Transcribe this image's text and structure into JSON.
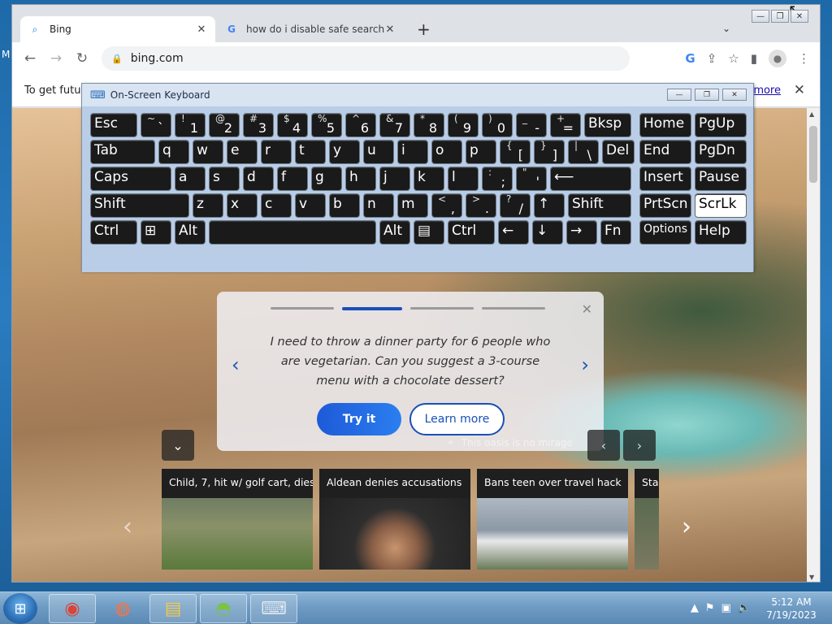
{
  "browser": {
    "tabs": [
      {
        "title": "Bing",
        "icon": "search-icon",
        "active": true
      },
      {
        "title": "how do i disable safe search - Gc",
        "icon": "google-icon",
        "active": false
      }
    ],
    "new_tab_label": "+",
    "address": "bing.com",
    "infobar": {
      "text": "To get future",
      "link": "more"
    }
  },
  "card": {
    "text": "I need to throw a dinner party for 6 people who are vegetarian. Can you suggest a 3-course menu with a chocolate dessert?",
    "try_it": "Try it",
    "learn_more": "Learn more"
  },
  "image_caption": "This oasis is no mirage",
  "news": [
    {
      "title": "Child, 7, hit w/ golf cart, dies"
    },
    {
      "title": "Aldean denies accusations"
    },
    {
      "title": "Bans teen over travel hack"
    },
    {
      "title": "Stal"
    }
  ],
  "osk": {
    "title": "On-Screen Keyboard",
    "rows": [
      [
        {
          "m": "Esc"
        },
        {
          "s": "~",
          "l": "`"
        },
        {
          "s": "!",
          "l": "1"
        },
        {
          "s": "@",
          "l": "2"
        },
        {
          "s": "#",
          "l": "3"
        },
        {
          "s": "$",
          "l": "4"
        },
        {
          "s": "%",
          "l": "5"
        },
        {
          "s": "^",
          "l": "6"
        },
        {
          "s": "&",
          "l": "7"
        },
        {
          "s": "*",
          "l": "8"
        },
        {
          "s": "(",
          "l": "9"
        },
        {
          "s": ")",
          "l": "0"
        },
        {
          "s": "_",
          "l": "-"
        },
        {
          "s": "+",
          "l": "="
        },
        {
          "m": "Bksp"
        },
        {
          "m": "Home"
        },
        {
          "m": "PgUp"
        }
      ],
      [
        {
          "m": "Tab"
        },
        {
          "m": "q"
        },
        {
          "m": "w"
        },
        {
          "m": "e"
        },
        {
          "m": "r"
        },
        {
          "m": "t"
        },
        {
          "m": "y"
        },
        {
          "m": "u"
        },
        {
          "m": "i"
        },
        {
          "m": "o"
        },
        {
          "m": "p"
        },
        {
          "s": "{",
          "l": "["
        },
        {
          "s": "}",
          "l": "]"
        },
        {
          "s": "|",
          "l": "\\"
        },
        {
          "m": "Del"
        },
        {
          "m": "End"
        },
        {
          "m": "PgDn"
        }
      ],
      [
        {
          "m": "Caps"
        },
        {
          "m": "a"
        },
        {
          "m": "s"
        },
        {
          "m": "d"
        },
        {
          "m": "f"
        },
        {
          "m": "g"
        },
        {
          "m": "h"
        },
        {
          "m": "j"
        },
        {
          "m": "k"
        },
        {
          "m": "l"
        },
        {
          "s": ":",
          "l": ";"
        },
        {
          "s": "\"",
          "l": "'"
        },
        {
          "m": "⟵"
        },
        {
          "m": "Insert"
        },
        {
          "m": "Pause"
        }
      ],
      [
        {
          "m": "Shift"
        },
        {
          "m": "z"
        },
        {
          "m": "x"
        },
        {
          "m": "c"
        },
        {
          "m": "v"
        },
        {
          "m": "b"
        },
        {
          "m": "n"
        },
        {
          "m": "m"
        },
        {
          "s": "<",
          "l": ","
        },
        {
          "s": ">",
          "l": "."
        },
        {
          "s": "?",
          "l": "/"
        },
        {
          "m": "↑"
        },
        {
          "m": "Shift"
        },
        {
          "m": "PrtScn"
        },
        {
          "m": "ScrLk",
          "active": true
        }
      ],
      [
        {
          "m": "Ctrl"
        },
        {
          "m": "⊞"
        },
        {
          "m": "Alt"
        },
        {
          "m": ""
        },
        {
          "m": "Alt"
        },
        {
          "m": "▤"
        },
        {
          "m": "Ctrl"
        },
        {
          "m": "←"
        },
        {
          "m": "↓"
        },
        {
          "m": "→"
        },
        {
          "m": "Fn"
        },
        {
          "m": "Options"
        },
        {
          "m": "Help"
        }
      ]
    ]
  },
  "desktop_label": "M",
  "taskbar": {
    "apps": [
      "chrome-icon",
      "firefox-icon",
      "explorer-icon",
      "android-icon",
      "keyboard-icon"
    ],
    "time": "5:12 AM",
    "date": "7/19/2023"
  }
}
